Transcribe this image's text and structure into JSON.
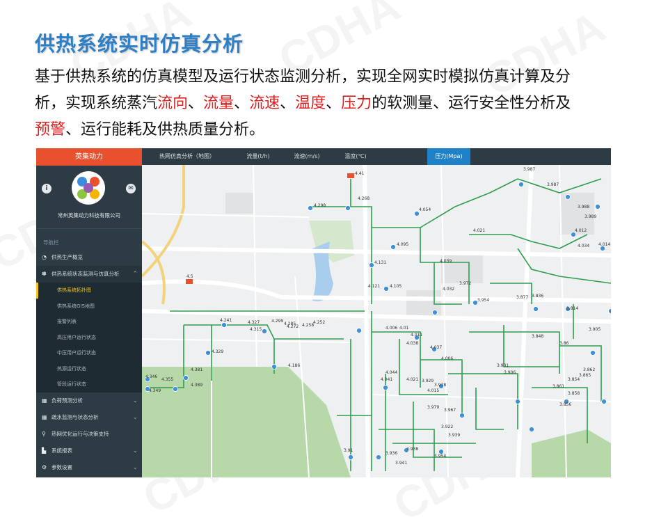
{
  "watermark": "CDHA",
  "slide": {
    "title": "供热系统实时仿真分析",
    "line1": "基于供热系统的仿真模型及运行状态监测分析，实现全网实时模拟仿真计算及分",
    "line2_prefix": "析，实现系统蒸汽",
    "kw_flow_dir": "流向",
    "sep": "、",
    "kw_flow": "流量",
    "kw_speed": "流速",
    "kw_temp": "温度",
    "kw_pressure": "压力",
    "line2_suffix": "的软测量、运行安全性分析及",
    "kw_warning": "预警",
    "line3_suffix": "、运行能耗及供热质量分析。"
  },
  "app": {
    "brand": "英集动力",
    "company": "常州英集动力科技有限公司",
    "info_icon": "i",
    "mail_icon": "✉",
    "nav_label": "导航栏",
    "nav": [
      {
        "label": "供热生产概览",
        "icon": "dashboard-icon"
      },
      {
        "label": "供热系统状态监测与仿真分析",
        "icon": "paw-icon"
      },
      {
        "label": "负荷预测分析",
        "icon": "table-icon"
      },
      {
        "label": "疏水监测与状态分析",
        "icon": "table-icon"
      },
      {
        "label": "热网优化运行与决策支持",
        "icon": "location-icon"
      },
      {
        "label": "系统报表",
        "icon": "bar-chart-icon"
      },
      {
        "label": "参数设置",
        "icon": "gears-icon"
      }
    ],
    "subnav": [
      "供热系统拓扑图",
      "供热系统GIS地图",
      "报警列表",
      "高压用户运行状态",
      "中压用户运行状态",
      "热源运行状态",
      "管段运行状态"
    ],
    "tabs": [
      "热网仿真分析（地图）",
      "流量(t/h)",
      "流速(m/s)",
      "温度(℃)",
      "压力(Mpa)"
    ],
    "map_labels": [
      "4.41",
      "4.268",
      "4.298",
      "3.987",
      "3.987",
      "3.988",
      "3.989",
      "4.012",
      "4.034",
      "4.014",
      "4.054",
      "4.021",
      "4.039",
      "4.095",
      "4.131",
      "4.121",
      "4.105",
      "4.032",
      "3.972",
      "3.954",
      "3.877",
      "3.836",
      "3.814",
      "4.5",
      "4.241",
      "4.327",
      "4.315",
      "4.299",
      "4.285",
      "4.272",
      "4.258",
      "4.252",
      "4.329",
      "4.381",
      "4.186",
      "4.346",
      "4.355",
      "4.389",
      "4.349",
      "4.006",
      "4.01",
      "4.011",
      "4.038",
      "4.037",
      "4.044",
      "4.041",
      "4.021",
      "4.015",
      "4.006",
      "3.901",
      "3.906",
      "3.929",
      "3.978",
      "3.979",
      "3.967",
      "3.922",
      "3.939",
      "3.954",
      "3.938",
      "3.936",
      "3.941",
      "3.91",
      "3.862",
      "3.865",
      "3.854",
      "3.858",
      "3.856",
      "3.861",
      "3.905",
      "3.848",
      "3.86"
    ]
  }
}
